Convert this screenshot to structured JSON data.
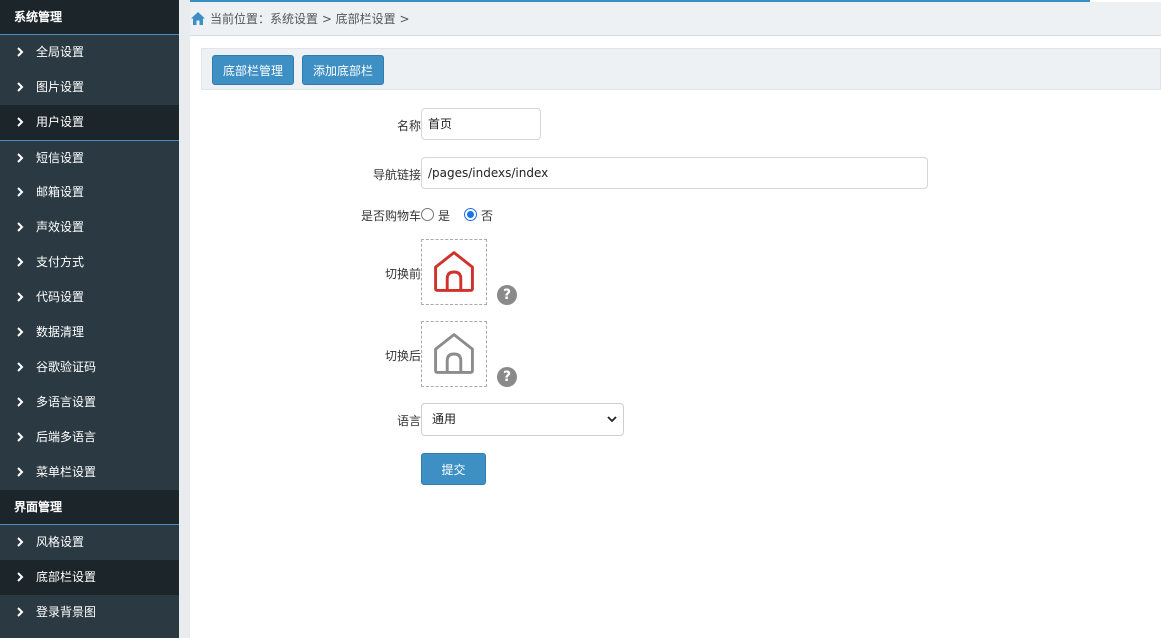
{
  "sidebar": {
    "sections": [
      {
        "title": "系统管理",
        "items": [
          "全局设置",
          "图片设置",
          "用户设置",
          "短信设置",
          "邮箱设置",
          "声效设置",
          "支付方式",
          "代码设置",
          "数据清理",
          "谷歌验证码",
          "多语言设置",
          "后端多语言",
          "菜单栏设置"
        ]
      },
      {
        "title": "界面管理",
        "items": [
          "风格设置",
          "底部栏设置",
          "登录背景图"
        ]
      }
    ]
  },
  "breadcrumb": {
    "text": "当前位置：系统设置 > 底部栏设置 >",
    "icon": "home-icon"
  },
  "toolbar": {
    "manage_label": "底部栏管理",
    "add_label": "添加底部栏"
  },
  "form": {
    "name_label": "名称",
    "name_value": "首页",
    "link_label": "导航链接",
    "link_value": "/pages/indexs/index",
    "cart_label": "是否购物车",
    "cart_yes": "是",
    "cart_no": "否",
    "cart_selected": "否",
    "before_label": "切换前",
    "after_label": "切换后",
    "lang_label": "语言",
    "lang_value": "通用",
    "submit_label": "提交",
    "help_glyph": "?"
  },
  "colors": {
    "accent": "#3d8fc4",
    "sidebar_bg": "#2b3a42",
    "sidebar_dark": "#1c2529",
    "home_icon_active": "#d0322b",
    "home_icon_inactive": "#8c8c8c"
  }
}
